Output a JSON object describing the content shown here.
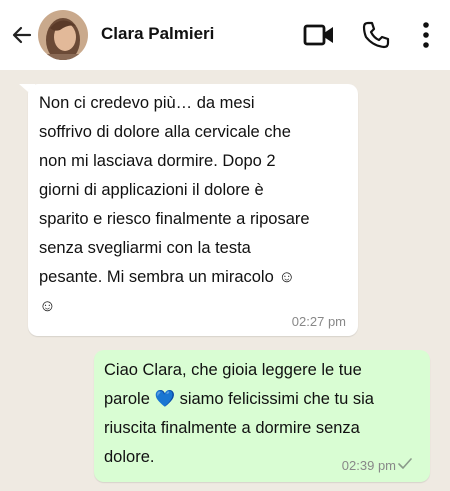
{
  "header": {
    "contact_name": "Clara Palmieri",
    "icons": [
      "back-arrow-icon",
      "video-call-icon",
      "phone-icon",
      "more-options-icon"
    ]
  },
  "messages": [
    {
      "direction": "incoming",
      "text": "Non ci credevo più… da mesi\nsoffrivo di dolore alla cervicale che\nnon mi lasciava dormire. Dopo 2\ngiorni di applicazioni il dolore è\nsparito e riesco finalmente a riposare\nsenza svegliarmi con la testa\npesante. Mi sembra un miracolo ☺\n☺",
      "time": "02:27 pm"
    },
    {
      "direction": "outgoing",
      "text": "Ciao Clara, che gioia leggere le tue\nparole 💙 siamo felicissimi che tu sia\nriuscita finalmente a dormire senza\ndolore.",
      "time": "02:39 pm",
      "status_icon": "sent-check-icon"
    }
  ],
  "colors": {
    "background": "#efeae2",
    "incoming_bubble": "#ffffff",
    "outgoing_bubble": "#d9fdd3",
    "timestamp": "#888888"
  }
}
